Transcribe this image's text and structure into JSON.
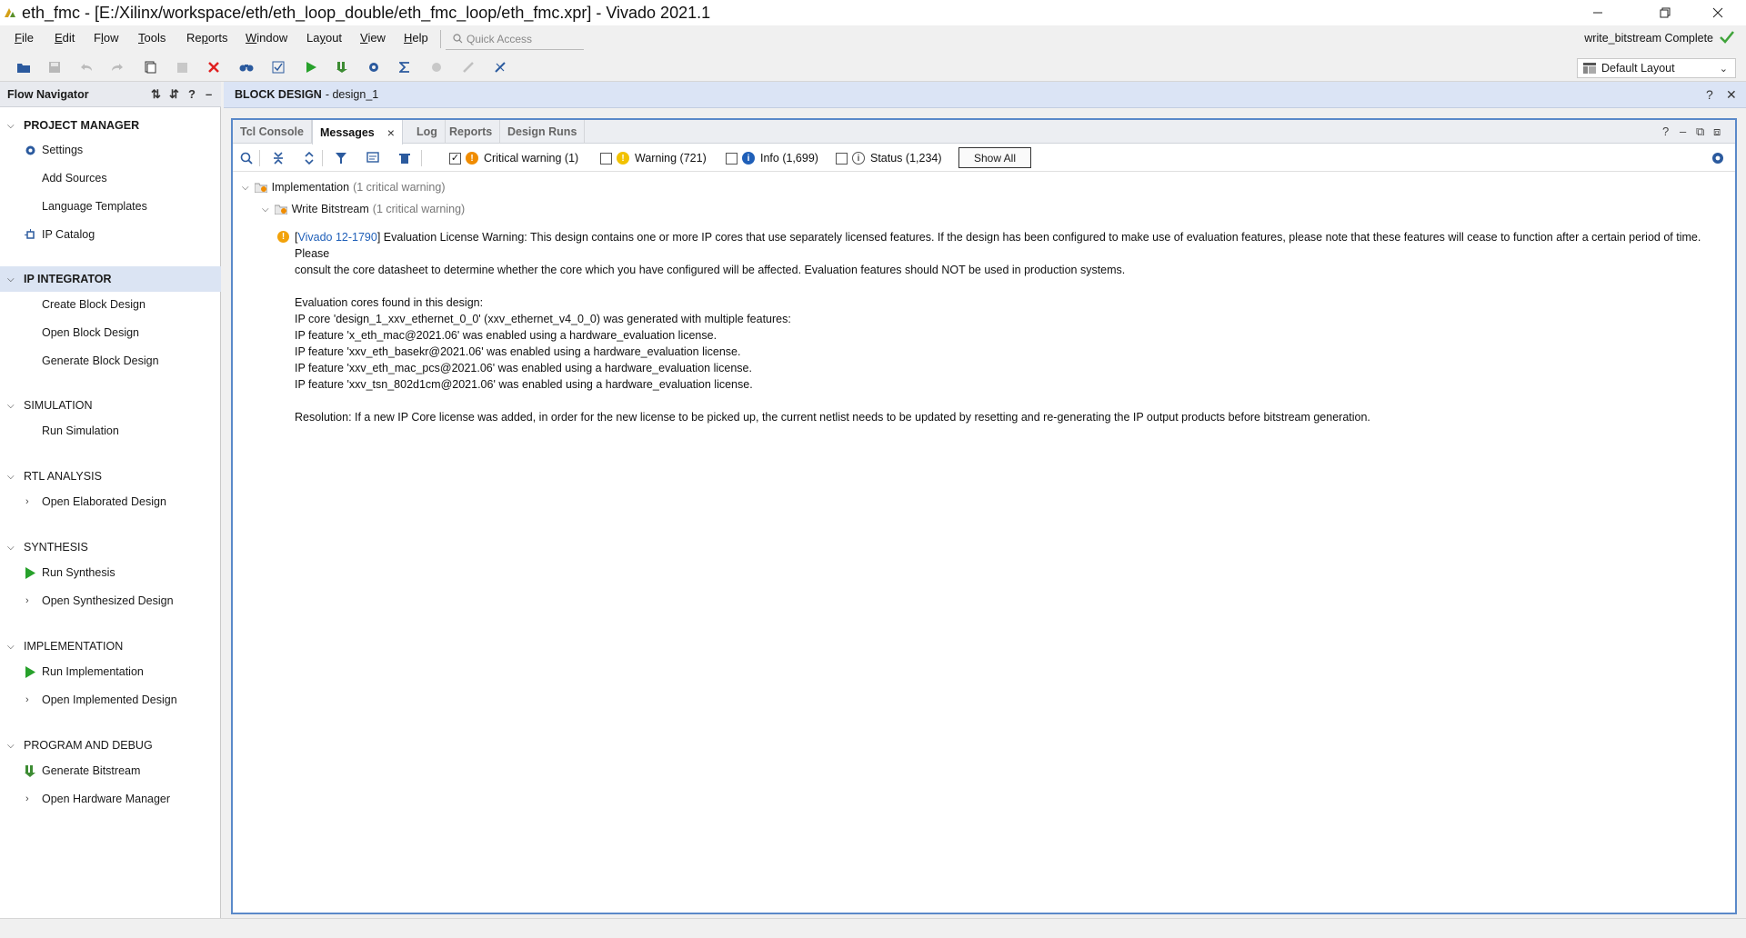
{
  "window": {
    "title": "eth_fmc - [E:/Xilinx/workspace/eth/eth_loop_double/eth_fmc_loop/eth_fmc.xpr] - Vivado 2021.1",
    "controls": [
      "minimize",
      "restore",
      "close"
    ]
  },
  "menubar": {
    "items": [
      {
        "label": "File",
        "mnemonic": "F"
      },
      {
        "label": "Edit",
        "mnemonic": "E"
      },
      {
        "label": "Flow",
        "mnemonic": "l"
      },
      {
        "label": "Tools",
        "mnemonic": "T"
      },
      {
        "label": "Reports",
        "mnemonic": "p"
      },
      {
        "label": "Window",
        "mnemonic": "W"
      },
      {
        "label": "Layout",
        "mnemonic": "y"
      },
      {
        "label": "View",
        "mnemonic": "V"
      },
      {
        "label": "Help",
        "mnemonic": "H"
      }
    ],
    "quick_access_placeholder": "Quick Access",
    "run_status": "write_bitstream Complete"
  },
  "toolbar": {
    "icons": [
      "open-project-icon",
      "save-icon",
      "undo-icon",
      "redo-icon",
      "copy-icon",
      "paste-icon",
      "delete-icon",
      "binoculars-icon",
      "checklist-icon",
      "run-icon",
      "program-icon",
      "settings-icon",
      "sigma-icon",
      "cancel-run-icon",
      "edit-disabled-icon",
      "debug-icon"
    ],
    "layout_selector": "Default Layout"
  },
  "flow_navigator": {
    "title": "Flow Navigator",
    "sections": [
      {
        "label": "PROJECT MANAGER",
        "items": [
          "Settings",
          "Add Sources",
          "Language Templates",
          "IP Catalog"
        ]
      },
      {
        "label": "IP INTEGRATOR",
        "items": [
          "Create Block Design",
          "Open Block Design",
          "Generate Block Design"
        ]
      },
      {
        "label": "SIMULATION",
        "items": [
          "Run Simulation"
        ]
      },
      {
        "label": "RTL ANALYSIS",
        "items": [
          "Open Elaborated Design"
        ]
      },
      {
        "label": "SYNTHESIS",
        "items": [
          "Run Synthesis",
          "Open Synthesized Design"
        ]
      },
      {
        "label": "IMPLEMENTATION",
        "items": [
          "Run Implementation",
          "Open Implemented Design"
        ]
      },
      {
        "label": "PROGRAM AND DEBUG",
        "items": [
          "Generate Bitstream",
          "Open Hardware Manager"
        ]
      }
    ]
  },
  "block_design": {
    "title": "BLOCK DESIGN",
    "name": "- design_1"
  },
  "panel": {
    "tabs": [
      "Tcl Console",
      "Messages",
      "Log",
      "Reports",
      "Design Runs"
    ],
    "active_tab": "Messages",
    "filters": [
      {
        "label": "Critical warning (1)",
        "checked": true,
        "color": "#f08c00"
      },
      {
        "label": "Warning (721)",
        "checked": false,
        "color": "#f2c200"
      },
      {
        "label": "Info (1,699)",
        "checked": false,
        "color": "#1f5fb8"
      },
      {
        "label": "Status (1,234)",
        "checked": false,
        "color": "#666666"
      }
    ],
    "show_all": "Show All"
  },
  "messages": {
    "group": {
      "label": "Implementation",
      "detail": "(1 critical warning)"
    },
    "subgroup": {
      "label": "Write Bitstream",
      "detail": "(1 critical warning)"
    },
    "message": {
      "id": "Vivado 12-1790",
      "line1": "Evaluation License Warning: This design contains one or more IP cores that use separately licensed features. If the design has been configured to make use of evaluation features, please note that these features will cease to function after a certain period of time. Please",
      "line2": "consult the core datasheet to determine whether the core which you have configured will be affected. Evaluation features should NOT be used in production systems.",
      "cores_header": "Evaluation cores found in this design:",
      "core_line": "IP core 'design_1_xxv_ethernet_0_0' (xxv_ethernet_v4_0_0) was generated with multiple features:",
      "features": [
        "IP feature 'x_eth_mac@2021.06' was enabled using a hardware_evaluation license.",
        "IP feature 'xxv_eth_basekr@2021.06' was enabled using a hardware_evaluation license.",
        "IP feature 'xxv_eth_mac_pcs@2021.06' was enabled using a hardware_evaluation license.",
        "IP feature 'xxv_tsn_802d1cm@2021.06' was enabled using a hardware_evaluation license."
      ],
      "resolution": "Resolution: If a new IP Core license was added, in order for the new license to be picked up, the current netlist needs to be updated by resetting and re-generating the IP output products before bitstream generation."
    }
  }
}
